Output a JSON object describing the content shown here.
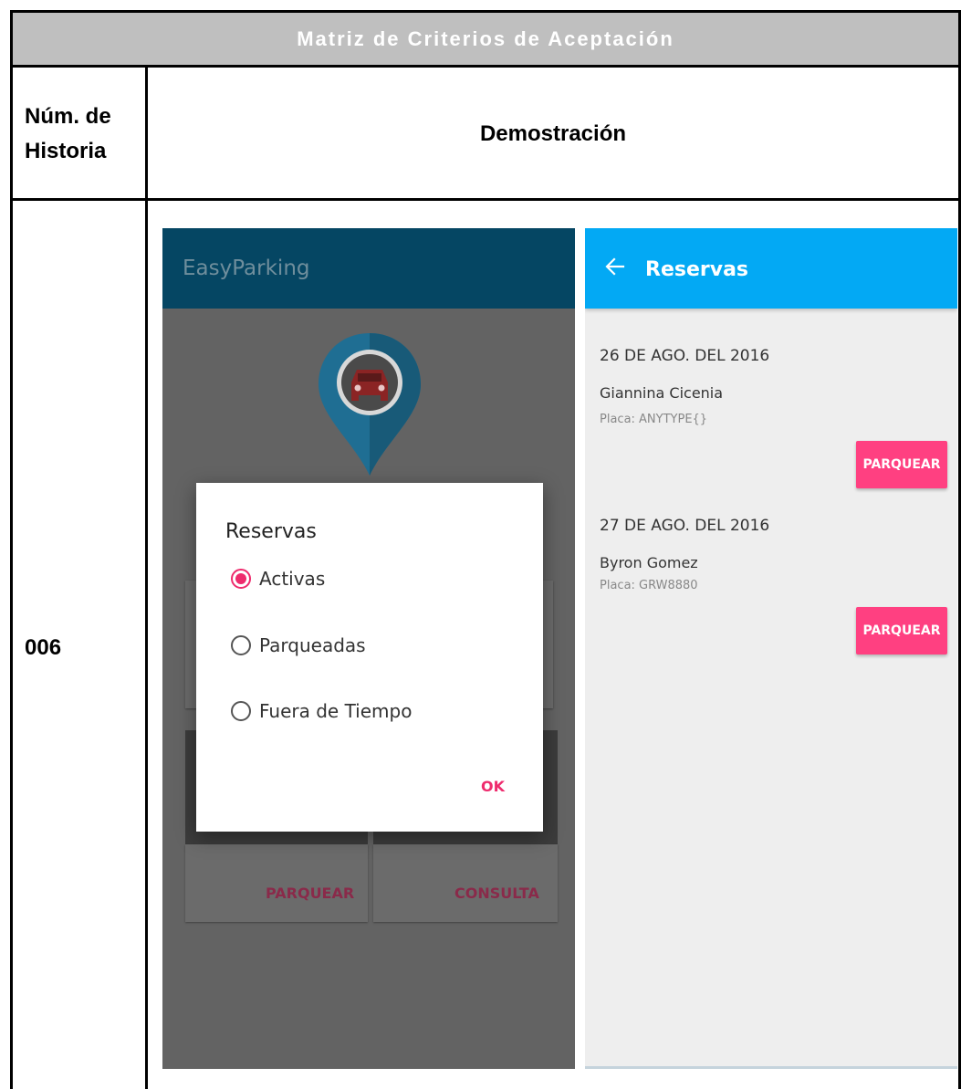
{
  "document": {
    "title": "Matriz de Criterios de Aceptación",
    "col_number_header": "Núm. de Historia",
    "col_number_header_line1": "Núm. de",
    "col_number_header_line2": "Historia",
    "col_demo_header": "Demostración",
    "story_number": "006"
  },
  "left_screen": {
    "app_title": "EasyParking",
    "cards": [
      {
        "label": "PARQUEAR"
      },
      {
        "label": "CONSULTA"
      }
    ],
    "dialog": {
      "title": "Reservas",
      "options": [
        {
          "label": "Activas",
          "selected": true
        },
        {
          "label": "Parqueadas",
          "selected": false
        },
        {
          "label": "Fuera de Tiempo",
          "selected": false
        }
      ],
      "ok_label": "OK"
    },
    "icons": {
      "pin": "map-pin-car-icon"
    },
    "colors": {
      "appbar": "#054663",
      "accent": "#ee2b6d",
      "pin": "#1f6e93"
    }
  },
  "right_screen": {
    "title": "Reservas",
    "reservations": [
      {
        "date": "26 DE AGO. DEL 2016",
        "name": "Giannina Cicenia",
        "plate": "Placa: ANYTYPE{}",
        "button": "PARQUEAR"
      },
      {
        "date": "27 DE AGO. DEL 2016",
        "name": "Byron Gomez",
        "plate": "Placa:  GRW8880",
        "button": "PARQUEAR"
      }
    ],
    "icons": {
      "back": "arrow-back-icon"
    },
    "colors": {
      "appbar": "#03a9f4",
      "button": "#ff4081"
    }
  }
}
